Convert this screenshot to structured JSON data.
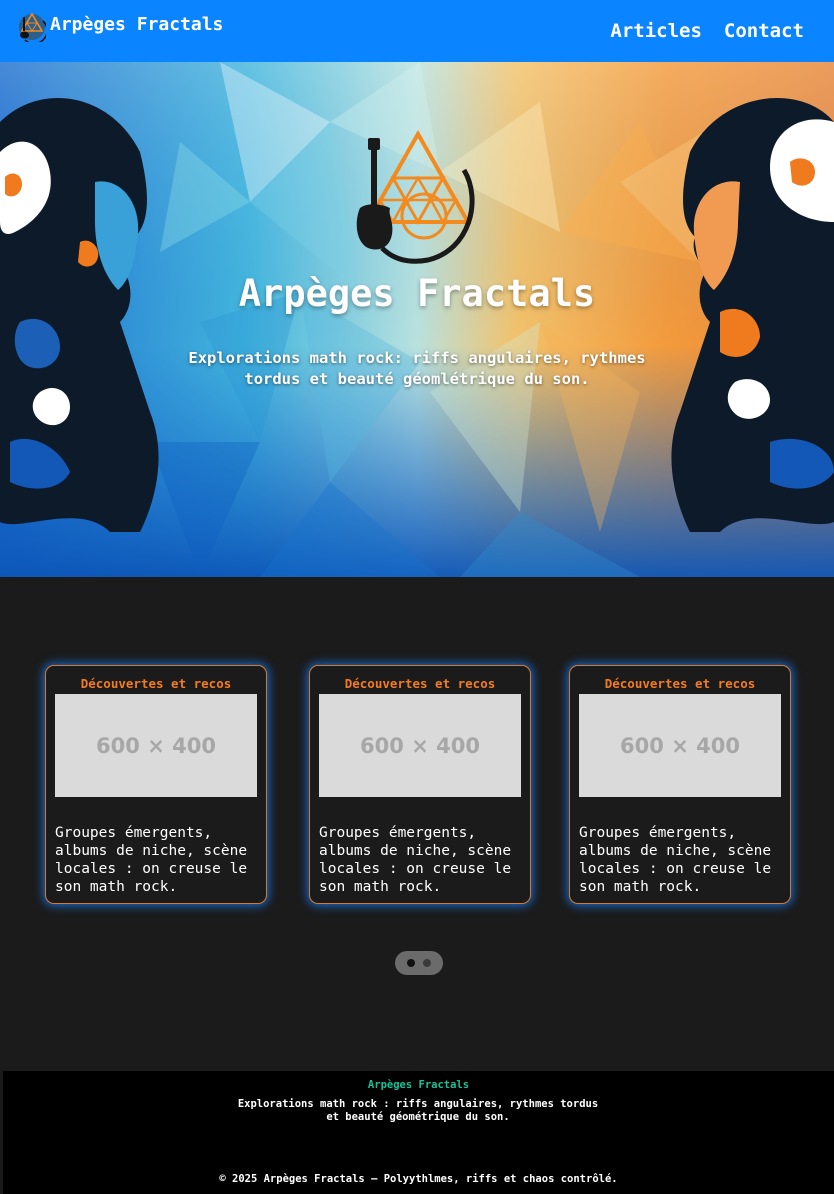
{
  "nav": {
    "brand": "Arpèges Fractals",
    "links": [
      "Articles",
      "Contact"
    ]
  },
  "hero": {
    "title": "Arpèges Fractals",
    "subtitle": "Explorations math rock: riffs angulaires, rythmes tordus et beauté géomlétrique du son."
  },
  "cards": [
    {
      "category": "Découvertes et recos",
      "image_placeholder": "600 × 400",
      "description": "Groupes émergents, albums de niche, scène locales : on creuse le son math rock."
    },
    {
      "category": "Découvertes et recos",
      "image_placeholder": "600 × 400",
      "description": "Groupes émergents, albums de niche, scène locales : on creuse le son math rock."
    },
    {
      "category": "Découvertes et recos",
      "image_placeholder": "600 × 400",
      "description": "Groupes émergents, albums de niche, scène locales : on creuse le son math rock."
    }
  ],
  "footer": {
    "title": "Arpèges Fractals",
    "description": "Explorations math rock : riffs angulaires, rythmes tordus et beauté géométrique du son.",
    "copyright": "© 2025 Arpèges Fractals – Polyythlmes, riffs et chaos contrôlé."
  },
  "colors": {
    "nav_bg": "#0a84ff",
    "card_border": "#d9792b",
    "card_glow": "#1680ff",
    "category_text": "#f47c20",
    "footer_title": "#15c39a",
    "page_bg": "#1b1b1b"
  },
  "icons": {
    "brand": "guitar-fractal-logo-icon",
    "hero": "guitar-fractal-logo-icon"
  }
}
